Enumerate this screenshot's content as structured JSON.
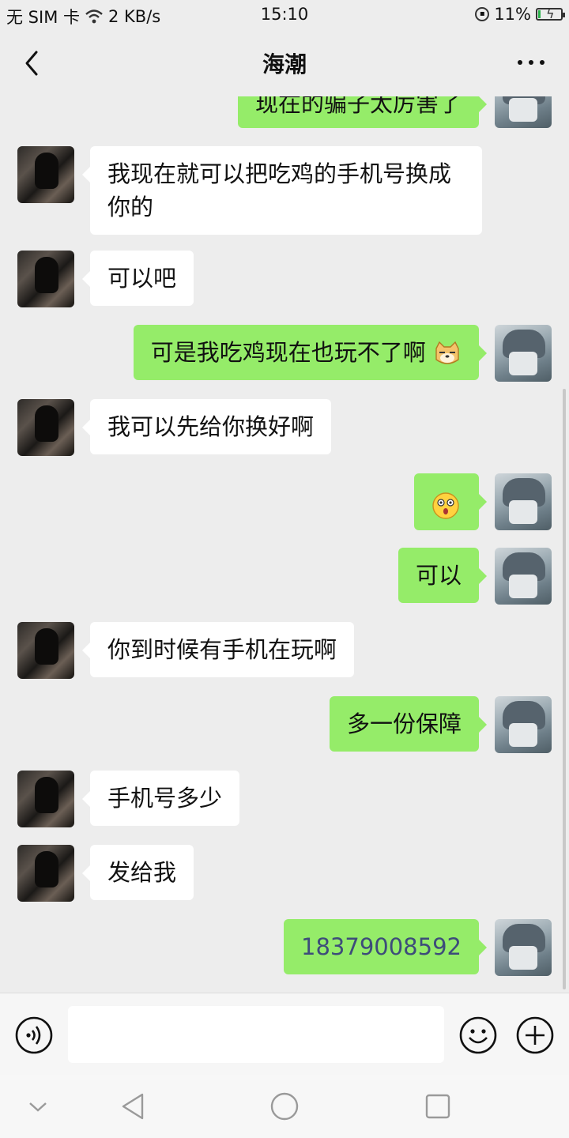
{
  "status_bar": {
    "carrier": "无 SIM 卡",
    "speed": "2 KB/s",
    "time": "15:10",
    "battery": "11%",
    "icons": [
      "wifi-icon",
      "lock-rotation-icon",
      "battery-charging-icon"
    ]
  },
  "header": {
    "title": "海潮",
    "icons": [
      "back-arrow-icon",
      "more-dots-icon"
    ]
  },
  "messages": [
    {
      "side": "out",
      "text": "现在的骗子太厉害了"
    },
    {
      "side": "in",
      "text": "我现在就可以把吃鸡的手机号换成你的"
    },
    {
      "side": "in",
      "text": "可以吧"
    },
    {
      "side": "out",
      "text": "可是我吃鸡现在也玩不了啊",
      "emoji": "doge-emoji"
    },
    {
      "side": "in",
      "text": "我可以先给你换好啊"
    },
    {
      "side": "out",
      "text": "",
      "emoji": "surprised-face-emoji"
    },
    {
      "side": "out",
      "text": "可以"
    },
    {
      "side": "in",
      "text": "你到时候有手机在玩啊"
    },
    {
      "side": "out",
      "text": "多一份保障"
    },
    {
      "side": "in",
      "text": "手机号多少"
    },
    {
      "side": "in",
      "text": "发给我"
    },
    {
      "side": "out",
      "text": "18379008592"
    }
  ],
  "input_bar": {
    "placeholder": "",
    "icons": [
      "voice-icon",
      "emoji-icon",
      "plus-icon"
    ]
  },
  "nav_bar": {
    "icons": [
      "collapse-icon",
      "back-triangle-icon",
      "home-circle-icon",
      "recents-square-icon"
    ]
  },
  "colors": {
    "background": "#ededed",
    "outgoing_bubble": "#95ec69",
    "incoming_bubble": "#ffffff",
    "phone_link": "#3d4c7a"
  }
}
